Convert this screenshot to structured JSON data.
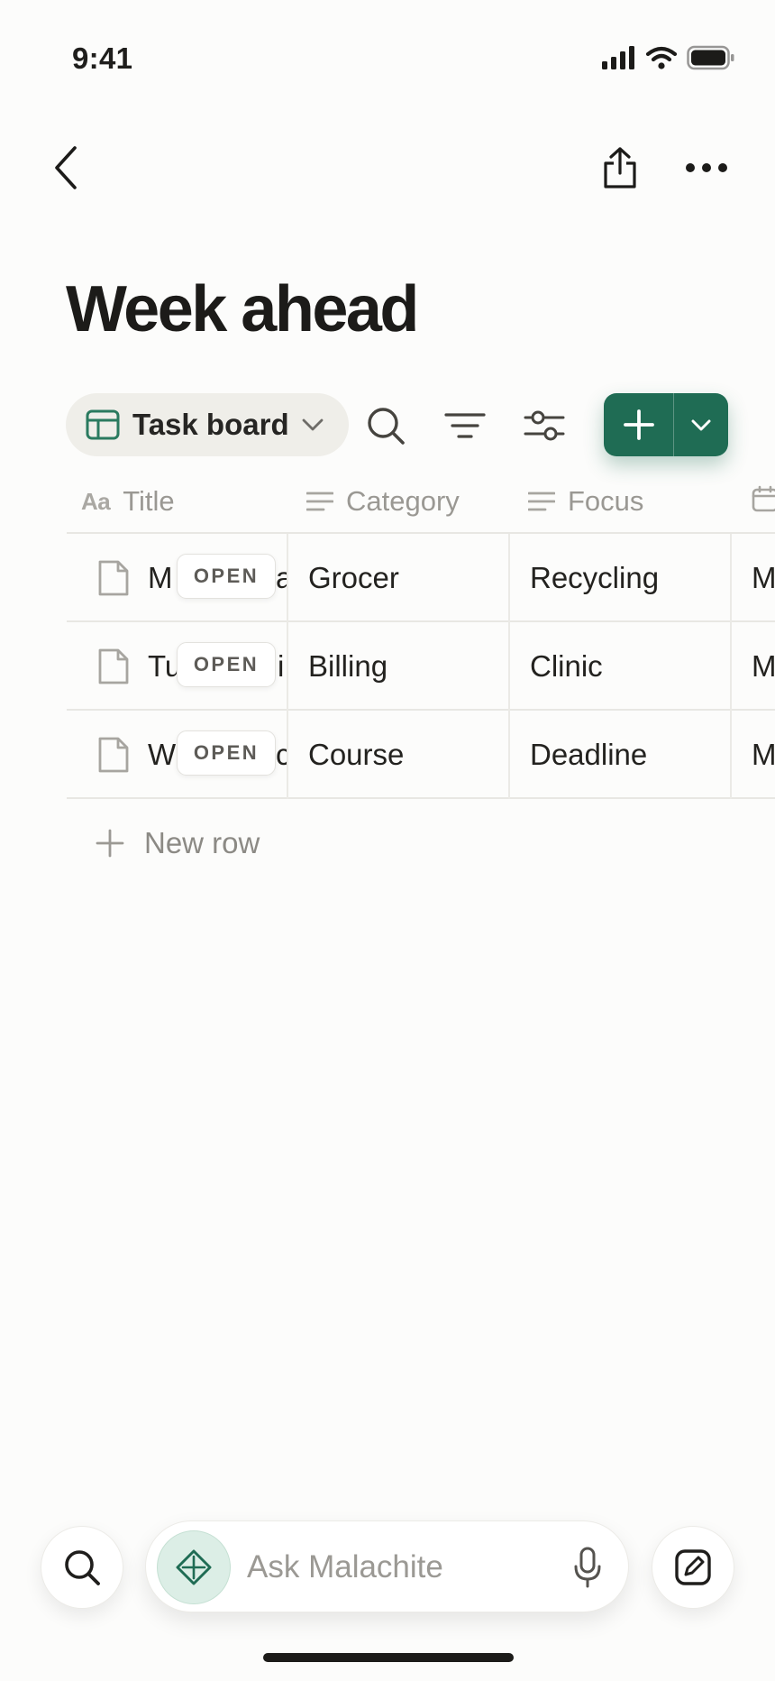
{
  "status_bar": {
    "time": "9:41"
  },
  "page": {
    "title": "Week ahead"
  },
  "toolbar": {
    "view_label": "Task board",
    "view_icon": "table-icon",
    "icons": [
      "search-icon",
      "filter-icon",
      "sliders-icon",
      "plus-icon",
      "chevron-down-icon"
    ]
  },
  "table": {
    "columns": [
      {
        "label": "Title",
        "icon": "Aa"
      },
      {
        "label": "Category",
        "icon": "text-lines-icon"
      },
      {
        "label": "Focus",
        "icon": "text-lines-icon"
      }
    ],
    "rows": [
      {
        "title": "M",
        "title_tail": "a",
        "open_label": "OPEN",
        "category": "Grocer",
        "focus": "Recycling",
        "next": "M"
      },
      {
        "title": "Tu",
        "title_tail": "i",
        "open_label": "OPEN",
        "category": "Billing",
        "focus": "Clinic",
        "next": "M"
      },
      {
        "title": "W",
        "title_tail": "c",
        "open_label": "OPEN",
        "category": "Course",
        "focus": "Deadline",
        "next": "M"
      }
    ],
    "new_row_label": "New row"
  },
  "bottom_bar": {
    "ask_placeholder": "Ask Malachite"
  },
  "colors": {
    "accent": "#1f6c54",
    "background": "#fcfcfb",
    "pill": "#efeee9",
    "muted_text": "#9a9893"
  }
}
